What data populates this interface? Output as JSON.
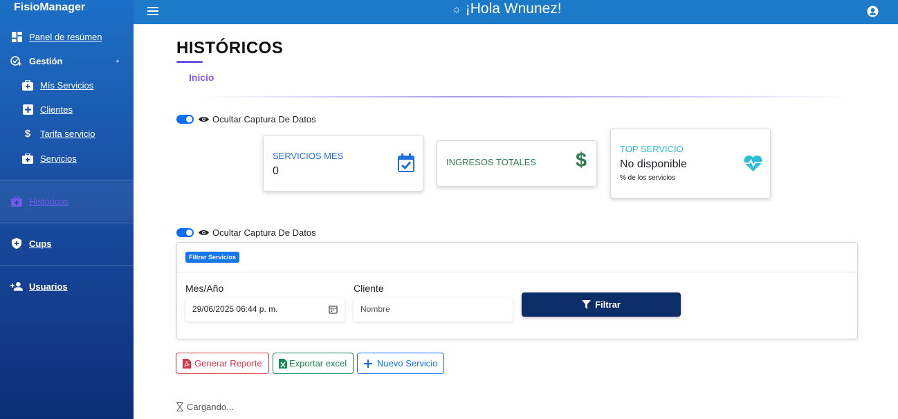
{
  "sidebar": {
    "brand": "FisioManager",
    "items": [
      {
        "label": "Panel de resúmen"
      },
      {
        "label": "Gestión"
      },
      {
        "label": "Mís Servicios"
      },
      {
        "label": "Clientes"
      },
      {
        "label": "Tarifa servicio"
      },
      {
        "label": "Servicios"
      },
      {
        "label": "Históricos"
      },
      {
        "label": "Cups"
      },
      {
        "label": "Usuarios"
      }
    ]
  },
  "header": {
    "greeting": "¡Hola Wnunez!"
  },
  "page": {
    "title": "HISTÓRICOS",
    "breadcrumb": "Inicio"
  },
  "toggles": {
    "label_1": "Ocultar Captura De Datos",
    "label_2": "Ocultar Captura De Datos"
  },
  "cards": {
    "servicios_mes": {
      "title": "SERVICIOS MES",
      "value": "0",
      "color": "#1f6fe0"
    },
    "ingresos": {
      "title": "INGRESOS TOTALES",
      "color": "#2e7d4f"
    },
    "top": {
      "title": "TOP SERVICIO",
      "value": "No disponible",
      "sub": "% de los servicios",
      "color": "#2bbfd9"
    }
  },
  "filter": {
    "badge": "Filtrar Servicios",
    "month_label": "Mes/Año",
    "month_value": "29/06/2025 06:44 p. m.",
    "client_label": "Cliente",
    "client_placeholder": "Nombre",
    "button": "Filtrar"
  },
  "actions": {
    "report": "Generar Reporte",
    "excel": "Exportar excel",
    "new": "Nuevo Servicio"
  },
  "status": {
    "loading": "Cargando..."
  },
  "colors": {
    "sidebar_top": "#1d6fc7",
    "sidebar_bottom": "#0e2d78",
    "topbar": "#1d7ac8",
    "accent_purple": "#6d4fe0",
    "report_red": "#dc3545",
    "excel_green": "#198754",
    "new_blue": "#0d6efd"
  }
}
